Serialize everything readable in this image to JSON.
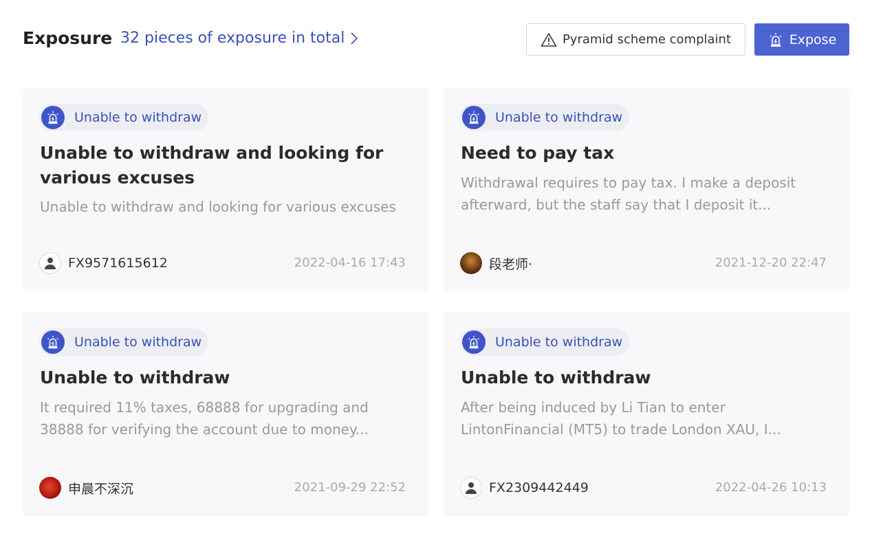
{
  "header": {
    "title": "Exposure",
    "total_link": "32 pieces of exposure in total",
    "complaint_button": "Pyramid scheme complaint",
    "expose_button": "Expose"
  },
  "cards": [
    {
      "tag": "Unable to withdraw",
      "title": "Unable to withdraw and looking for various excuses",
      "description": "Unable to withdraw and looking for various excuses",
      "author": "FX9571615612",
      "avatar": "default-user-icon",
      "date": "2022-04-16 17:43"
    },
    {
      "tag": "Unable to withdraw",
      "title": "Need to pay tax",
      "description": "Withdrawal requires to pay tax. I make a deposit afterward, but the staff say that I deposit it...",
      "author": "段老师·",
      "avatar": "user-photo",
      "date": "2021-12-20 22:47"
    },
    {
      "tag": "Unable to withdraw",
      "title": "Unable to withdraw",
      "description": "It required 11% taxes, 68888 for upgrading and 38888 for verifying the account due to money...",
      "author": "申晨不深沉",
      "avatar": "user-photo",
      "date": "2021-09-29 22:52"
    },
    {
      "tag": "Unable to withdraw",
      "title": "Unable to withdraw",
      "description": "After being induced by Li Tian to enter LintonFinancial (MT5) to trade London XAU, I...",
      "author": "FX2309442449",
      "avatar": "default-user-icon",
      "date": "2022-04-26 10:13"
    }
  ],
  "colors": {
    "accent": "#4c63d2",
    "link": "#3b4fb8",
    "card_bg": "#f8f8fa"
  }
}
